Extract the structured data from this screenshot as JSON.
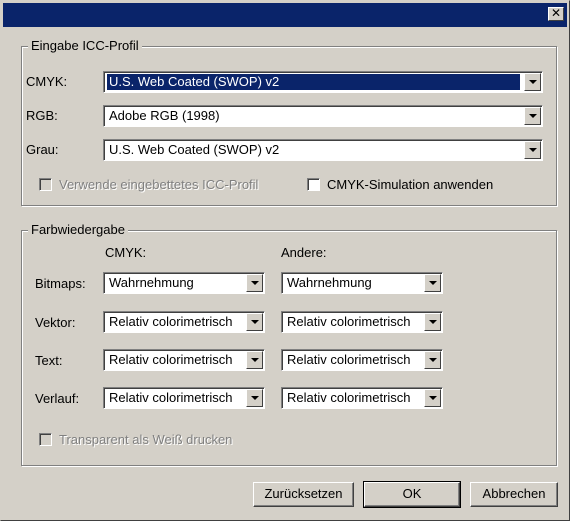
{
  "titlebar": {
    "close_glyph": "✕",
    "colors": {
      "background": "#0a246a"
    }
  },
  "input_profile": {
    "title": "Eingabe ICC-Profil",
    "cmyk": {
      "label": "CMYK:",
      "value": "U.S. Web Coated (SWOP) v2"
    },
    "rgb": {
      "label": "RGB:",
      "value": "Adobe RGB (1998)"
    },
    "gray": {
      "label": "Grau:",
      "value": "U.S. Web Coated (SWOP) v2"
    },
    "use_embedded_label": "Verwende eingebettetes ICC-Profil",
    "cmyk_simulation_label": "CMYK-Simulation anwenden"
  },
  "rendering": {
    "title": "Farbwiedergabe",
    "col_cmyk": "CMYK:",
    "col_other": "Andere:",
    "rows": [
      {
        "label": "Bitmaps:",
        "cmyk": "Wahrnehmung",
        "other": "Wahrnehmung"
      },
      {
        "label": "Vektor:",
        "cmyk": "Relativ colorimetrisch",
        "other": "Relativ colorimetrisch"
      },
      {
        "label": "Text:",
        "cmyk": "Relativ colorimetrisch",
        "other": "Relativ colorimetrisch"
      },
      {
        "label": "Verlauf:",
        "cmyk": "Relativ colorimetrisch",
        "other": "Relativ colorimetrisch"
      }
    ],
    "transparent_white_label": "Transparent als Weiß drucken"
  },
  "buttons": {
    "reset": "Zurücksetzen",
    "ok": "OK",
    "cancel": "Abbrechen"
  }
}
